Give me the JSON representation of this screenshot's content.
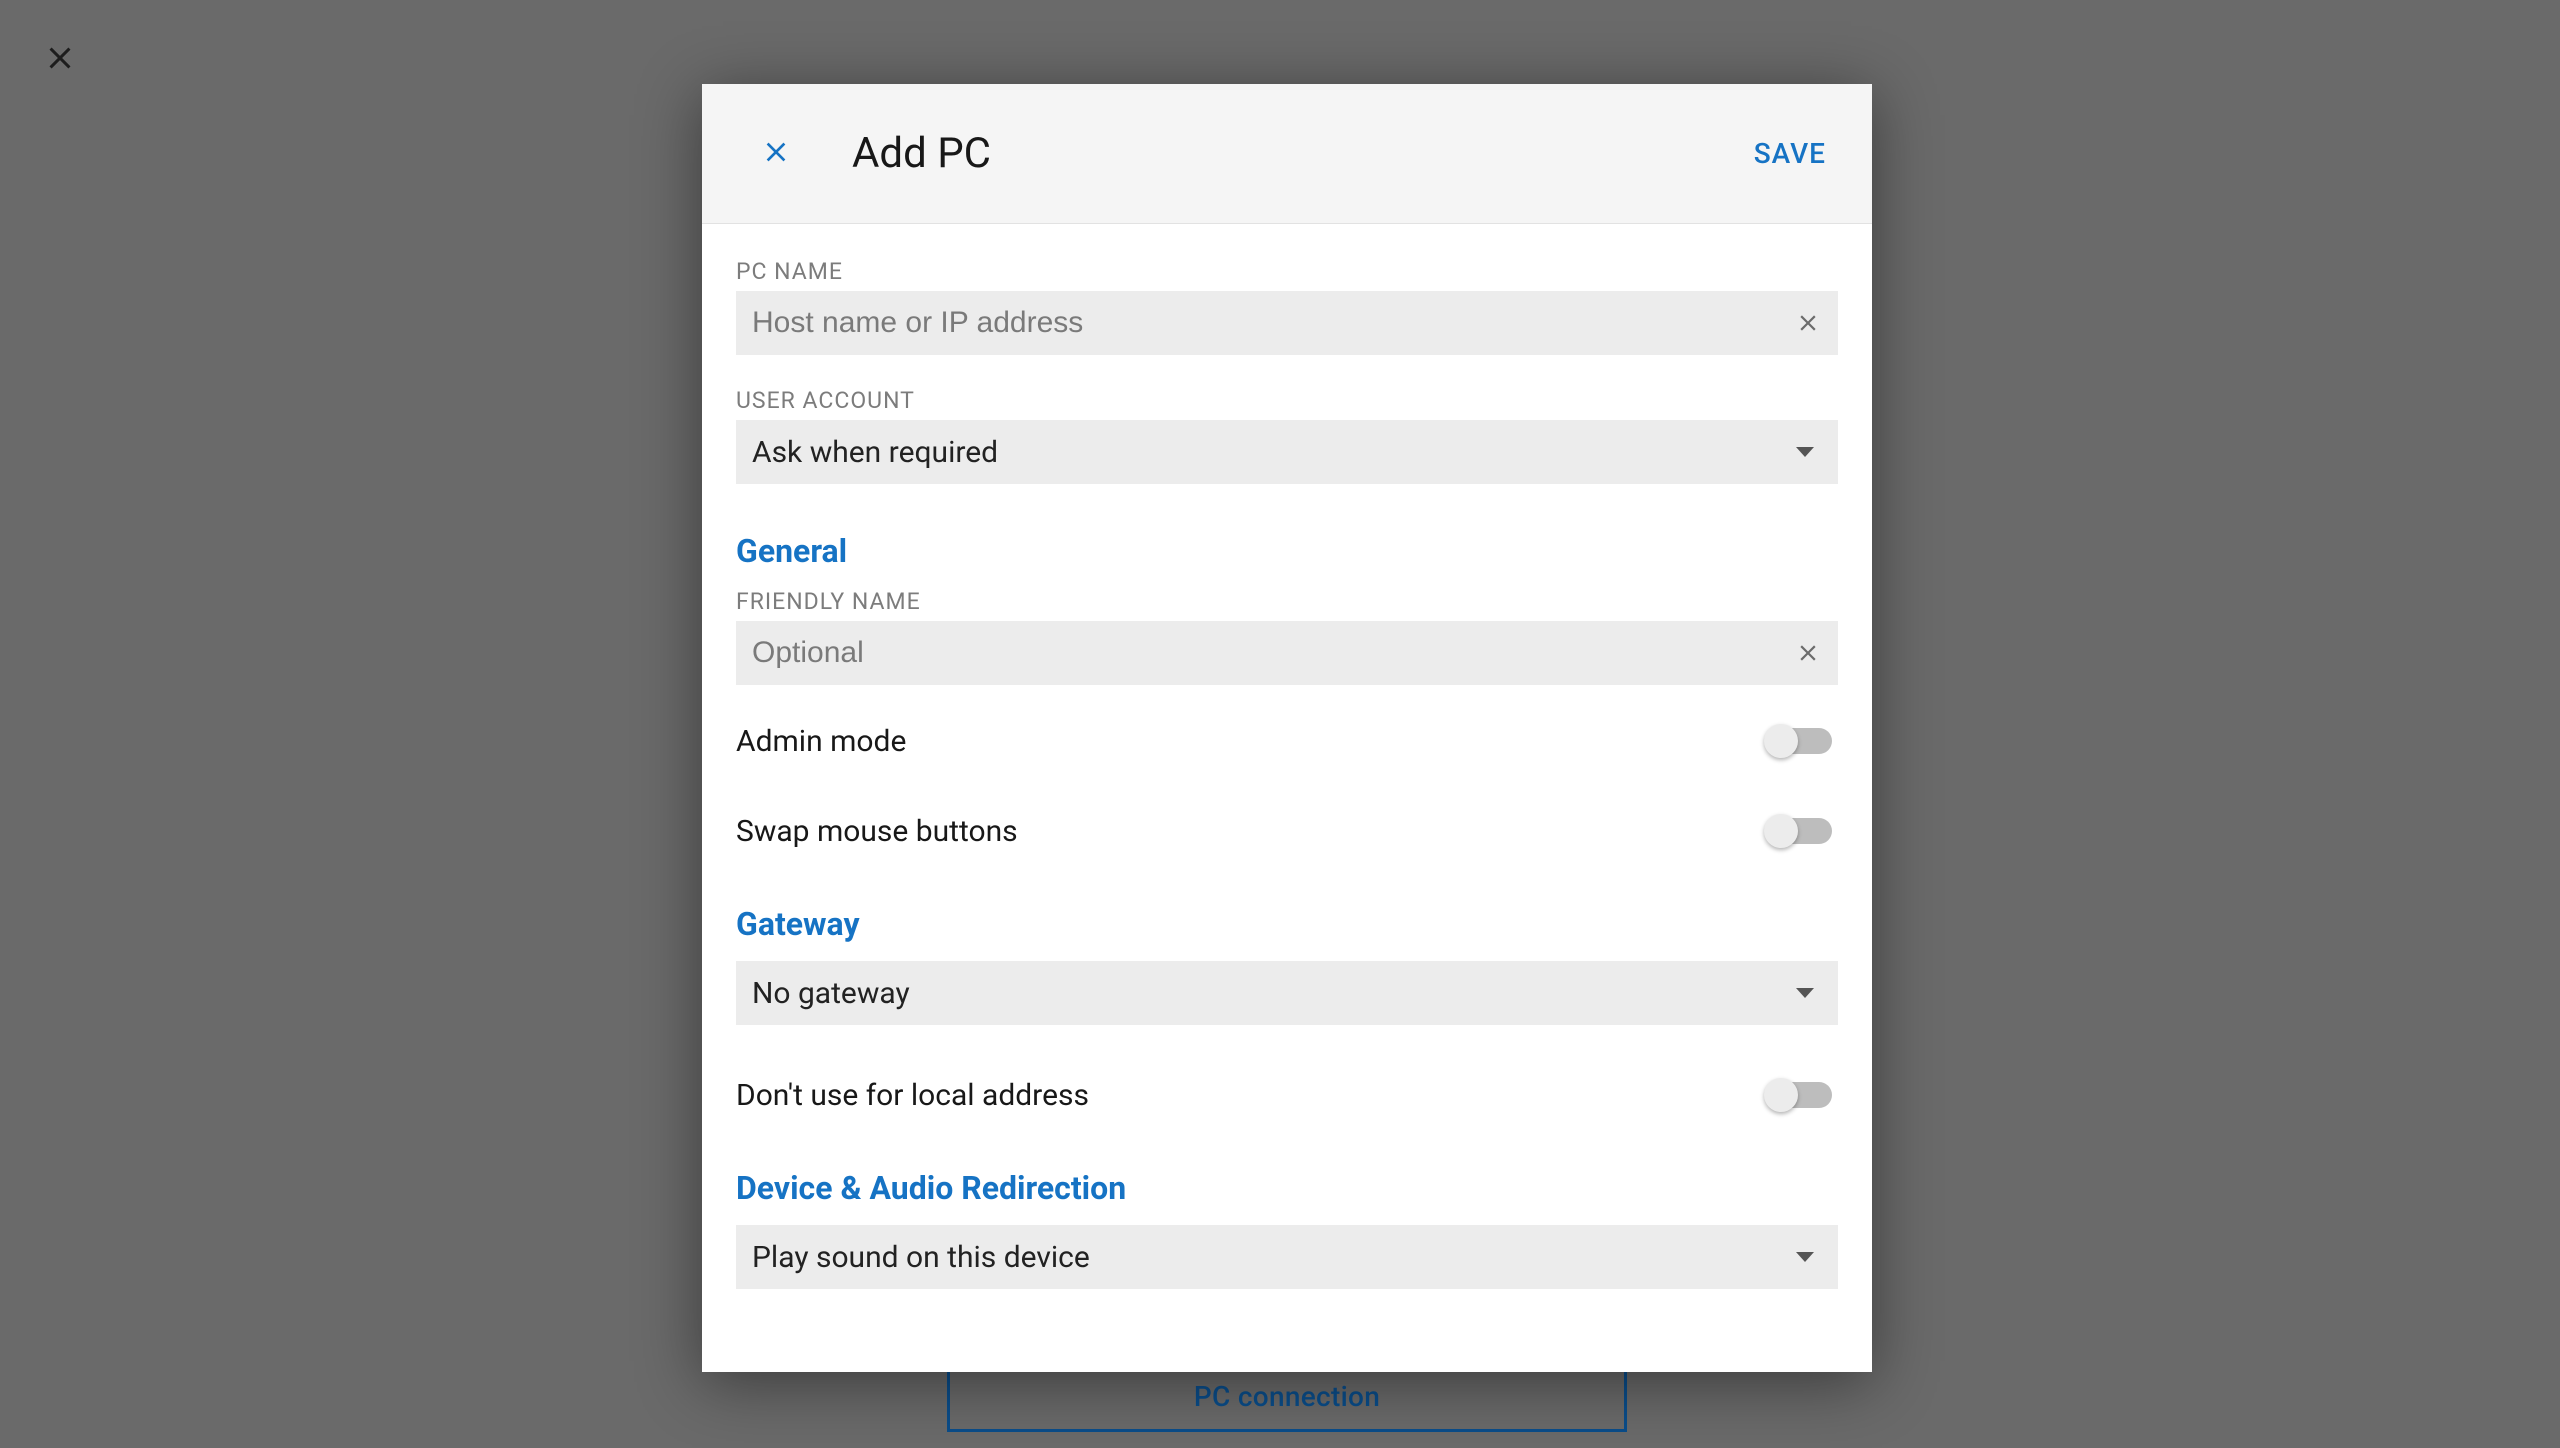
{
  "colors": {
    "accent": "#1673c4",
    "backdrop": "#6a6a6a"
  },
  "background": {
    "pc_connection_button": "PC connection"
  },
  "modal": {
    "title": "Add PC",
    "save_label": "SAVE",
    "fields": {
      "pc_name": {
        "label": "PC NAME",
        "placeholder": "Host name or IP address",
        "value": ""
      },
      "user_account": {
        "label": "USER ACCOUNT",
        "value": "Ask when required"
      },
      "friendly_name": {
        "label": "FRIENDLY NAME",
        "placeholder": "Optional",
        "value": ""
      }
    },
    "sections": {
      "general": "General",
      "gateway": "Gateway",
      "device_audio": "Device & Audio Redirection"
    },
    "toggles": {
      "admin_mode": {
        "label": "Admin mode",
        "state": false
      },
      "swap_mouse": {
        "label": "Swap mouse buttons",
        "state": false
      },
      "dont_use_local": {
        "label": "Don't use for local address",
        "state": false
      }
    },
    "gateway_select": {
      "value": "No gateway"
    },
    "sound_select": {
      "value": "Play sound on this device"
    }
  }
}
